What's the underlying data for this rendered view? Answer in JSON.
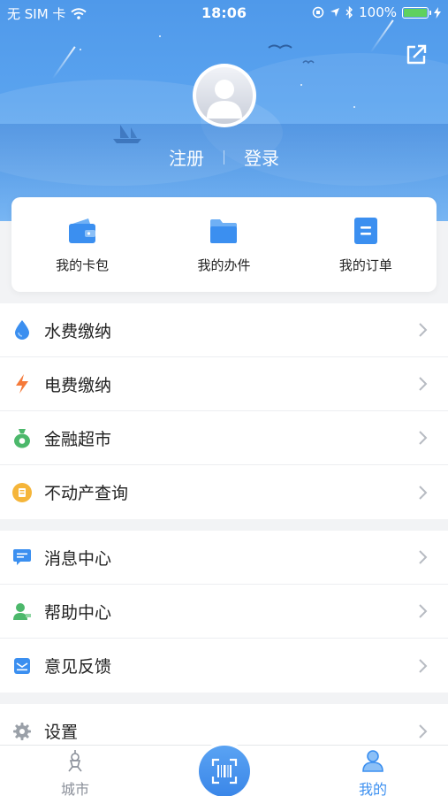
{
  "status_bar": {
    "carrier": "无 SIM 卡",
    "time": "18:06",
    "battery_text": "100%",
    "battery_level": 1.0
  },
  "header": {
    "register_label": "注册",
    "login_label": "登录",
    "share_icon": "share-icon",
    "avatar_icon": "default-avatar"
  },
  "quick_actions": [
    {
      "label": "我的卡包",
      "icon": "wallet-icon"
    },
    {
      "label": "我的办件",
      "icon": "folder-icon"
    },
    {
      "label": "我的订单",
      "icon": "order-icon"
    }
  ],
  "menu_groups": [
    [
      {
        "label": "水费缴纳",
        "icon": "water-drop-icon"
      },
      {
        "label": "电费缴纳",
        "icon": "lightning-icon"
      },
      {
        "label": "金融超市",
        "icon": "money-bag-icon"
      },
      {
        "label": "不动产查询",
        "icon": "property-icon"
      }
    ],
    [
      {
        "label": "消息中心",
        "icon": "message-icon"
      },
      {
        "label": "帮助中心",
        "icon": "help-person-icon"
      },
      {
        "label": "意见反馈",
        "icon": "feedback-mail-icon"
      }
    ],
    [
      {
        "label": "设置",
        "icon": "gear-icon"
      }
    ]
  ],
  "tab_bar": {
    "city_label": "城市",
    "mine_label": "我的",
    "active": "我的",
    "scan_icon": "scan-icon"
  },
  "colors": {
    "primary": "#3b8ff0",
    "header_top": "#4f99ea",
    "page_bg": "#f2f3f5"
  }
}
